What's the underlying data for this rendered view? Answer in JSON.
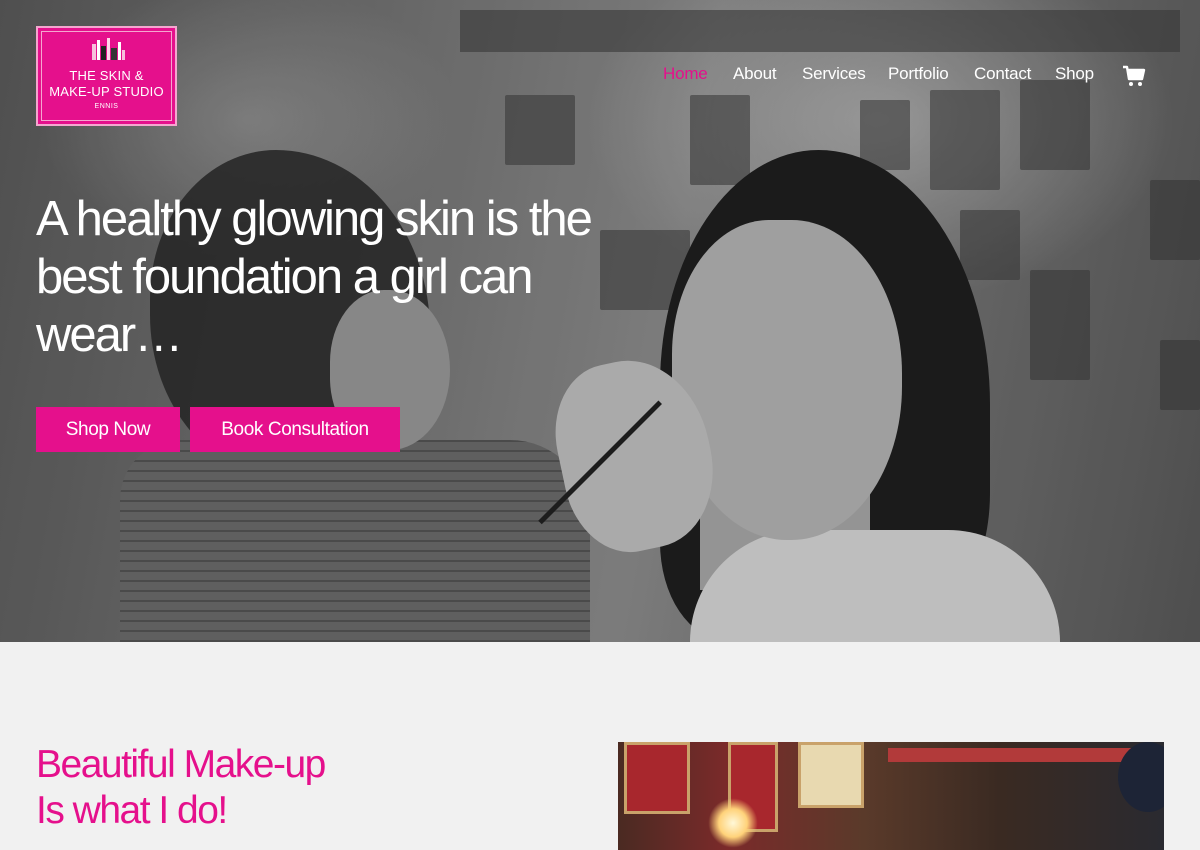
{
  "logo": {
    "line1": "THE SKIN &",
    "line2": "MAKE-UP STUDIO",
    "line3": "ENNIS"
  },
  "nav": {
    "items": [
      {
        "label": "Home",
        "active": true
      },
      {
        "label": "About",
        "active": false
      },
      {
        "label": "Services",
        "active": false
      },
      {
        "label": "Portfolio",
        "active": false
      },
      {
        "label": "Contact",
        "active": false
      },
      {
        "label": "Shop",
        "active": false
      }
    ],
    "cart_icon": "shopping-cart-icon"
  },
  "hero": {
    "headline": "A healthy glowing skin is the best foundation a girl can wear…",
    "buttons": {
      "shop": "Shop Now",
      "book": "Book Consultation"
    }
  },
  "about": {
    "title_line1": "Beautiful Make-up",
    "title_line2": "Is what I do!"
  },
  "colors": {
    "accent": "#e5108c",
    "page_background": "#f1f1f1",
    "text_on_dark": "#ffffff"
  }
}
